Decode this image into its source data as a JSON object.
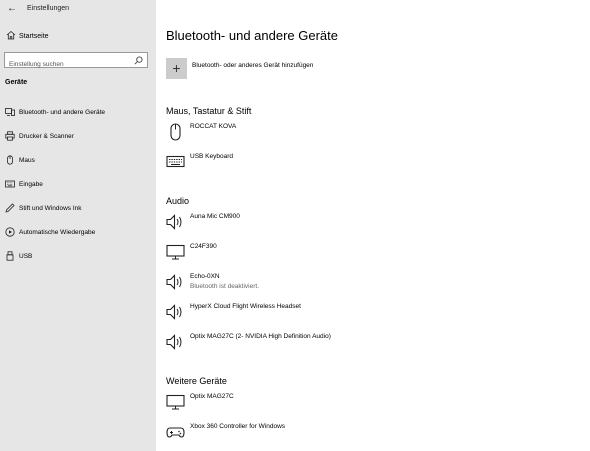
{
  "window": {
    "title": "Einstellungen"
  },
  "sidebar": {
    "home": "Startseite",
    "search_placeholder": "Einstellung suchen",
    "section_header": "Geräte",
    "items": [
      {
        "label": "Bluetooth- und andere Geräte",
        "icon": "bluetooth-devices-icon"
      },
      {
        "label": "Drucker & Scanner",
        "icon": "printer-icon"
      },
      {
        "label": "Maus",
        "icon": "mouse-icon"
      },
      {
        "label": "Eingabe",
        "icon": "keyboard-icon"
      },
      {
        "label": "Stift und Windows Ink",
        "icon": "pen-icon"
      },
      {
        "label": "Automatische Wiedergabe",
        "icon": "autoplay-icon"
      },
      {
        "label": "USB",
        "icon": "usb-icon"
      }
    ]
  },
  "main": {
    "title": "Bluetooth- und andere Geräte",
    "add_device": "Bluetooth- oder anderes Gerät hinzufügen",
    "groups": [
      {
        "title": "Maus, Tastatur & Stift",
        "devices": [
          {
            "name": "ROCCAT KOVA",
            "status": "",
            "icon": "mouse-icon"
          },
          {
            "name": "USB Keyboard",
            "status": "",
            "icon": "keyboard-icon"
          }
        ]
      },
      {
        "title": "Audio",
        "devices": [
          {
            "name": "Auna Mic CM900",
            "status": "",
            "icon": "speaker-icon"
          },
          {
            "name": "C24F390",
            "status": "",
            "icon": "monitor-icon"
          },
          {
            "name": "Echo-0XN",
            "status": "Bluetooth ist deaktiviert.",
            "icon": "speaker-icon"
          },
          {
            "name": "HyperX Cloud Flight Wireless Headset",
            "status": "",
            "icon": "speaker-icon"
          },
          {
            "name": "Optix MAG27C (2- NVIDIA High Definition Audio)",
            "status": "",
            "icon": "speaker-icon"
          }
        ]
      },
      {
        "title": "Weitere Geräte",
        "devices": [
          {
            "name": "Optix MAG27C",
            "status": "",
            "icon": "monitor-icon"
          },
          {
            "name": "Xbox 360 Controller for Windows",
            "status": "",
            "icon": "gamepad-icon"
          }
        ]
      }
    ]
  },
  "colors": {
    "sidebar_bg": "#e6e6e6",
    "main_bg": "#ffffff",
    "add_button_bg": "#cccccc",
    "status_text": "#666666"
  }
}
